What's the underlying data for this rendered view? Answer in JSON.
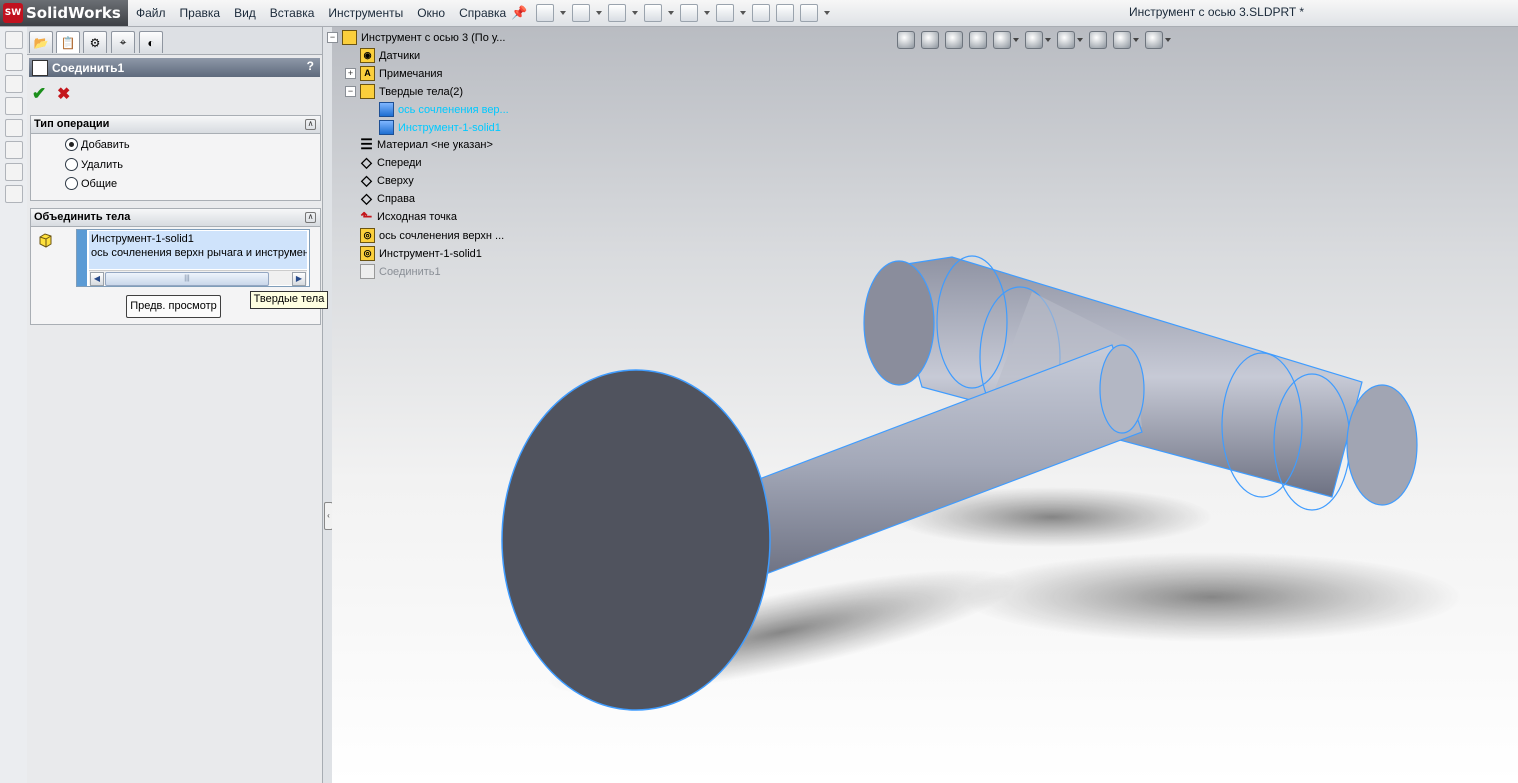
{
  "app": {
    "name": "SolidWorks",
    "logo_text": "SW"
  },
  "menu": [
    "Файл",
    "Правка",
    "Вид",
    "Вставка",
    "Инструменты",
    "Окно",
    "Справка"
  ],
  "document_title": "Инструмент с осью 3.SLDPRT *",
  "property_manager": {
    "title": "Соединить1",
    "help": "?",
    "ok": "✔",
    "cancel": "✖",
    "operation_type": {
      "header": "Тип операции",
      "options": [
        "Добавить",
        "Удалить",
        "Общие"
      ],
      "selected": "Добавить"
    },
    "combine_bodies": {
      "header": "Объединить тела",
      "items": [
        "Инструмент-1-solid1",
        "ось  сочленения верхн рычага и инструмент..."
      ],
      "preview_button": "Предв. просмотр"
    },
    "tooltip": "Твердые тела"
  },
  "tree": {
    "root": "Инструмент с осью 3  (По у...",
    "items": [
      {
        "label": "Датчики",
        "icon": "sensor-icon"
      },
      {
        "label": "Примечания",
        "icon": "annotation-icon"
      },
      {
        "label": "Твердые тела(2)",
        "icon": "solid-bodies-folder-icon"
      },
      {
        "label": "ось  сочленения вер...",
        "icon": "solid-body-icon",
        "highlight": true
      },
      {
        "label": "Инструмент-1-solid1",
        "icon": "solid-body-icon",
        "highlight": true
      },
      {
        "label": "Материал <не указан>",
        "icon": "material-icon"
      },
      {
        "label": "Спереди",
        "icon": "plane-icon"
      },
      {
        "label": "Сверху",
        "icon": "plane-icon"
      },
      {
        "label": "Справа",
        "icon": "plane-icon"
      },
      {
        "label": "Исходная точка",
        "icon": "origin-icon"
      },
      {
        "label": "ось  сочленения верхн ...",
        "icon": "imported-body-icon"
      },
      {
        "label": "Инструмент-1-solid1",
        "icon": "imported-body-icon"
      },
      {
        "label": "Соединить1",
        "icon": "combine-feature-icon",
        "greyed": true
      }
    ]
  },
  "colors": {
    "model_face": "#4d505c",
    "model_side": "#9ca1b1",
    "edge_highlight": "#3f9cff",
    "accent_blue": "#5b9bd5"
  }
}
